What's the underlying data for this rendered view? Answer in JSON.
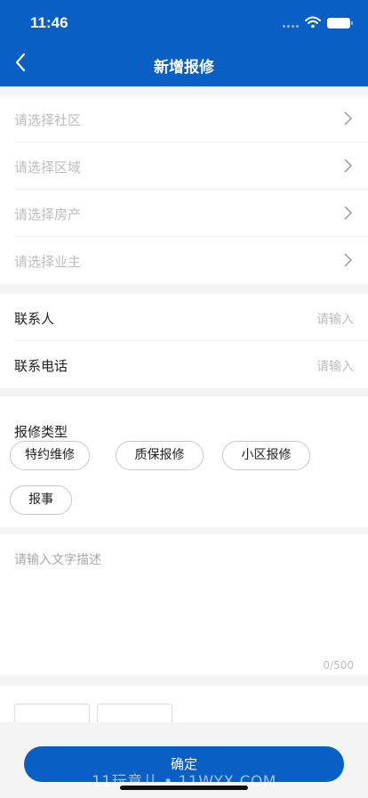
{
  "status_bar": {
    "time": "11:46",
    "icons": [
      "signal-icon",
      "wifi-icon",
      "battery-icon"
    ]
  },
  "nav": {
    "back_icon": "chevron-left-icon",
    "title": "新增报修"
  },
  "selectors": [
    {
      "placeholder": "请选择社区"
    },
    {
      "placeholder": "请选择区域"
    },
    {
      "placeholder": "请选择房产"
    },
    {
      "placeholder": "请选择业主"
    }
  ],
  "contact": {
    "name": {
      "label": "联系人",
      "placeholder": "请输入"
    },
    "phone": {
      "label": "联系电话",
      "placeholder": "请输入"
    }
  },
  "repair_type": {
    "title": "报修类型",
    "options": [
      "特约维修",
      "质保报修",
      "小区报修",
      "报事"
    ]
  },
  "description": {
    "placeholder": "请输入文字描述",
    "counter": "0/500"
  },
  "photos": {
    "add_icon": "plus-icon"
  },
  "footer": {
    "confirm_label": "确定",
    "watermark": "11玩意儿 • 11WYX.COM"
  },
  "colors": {
    "primary": "#0a5fc4",
    "background": "#f4f4f4",
    "placeholder": "#bdbdbd"
  }
}
